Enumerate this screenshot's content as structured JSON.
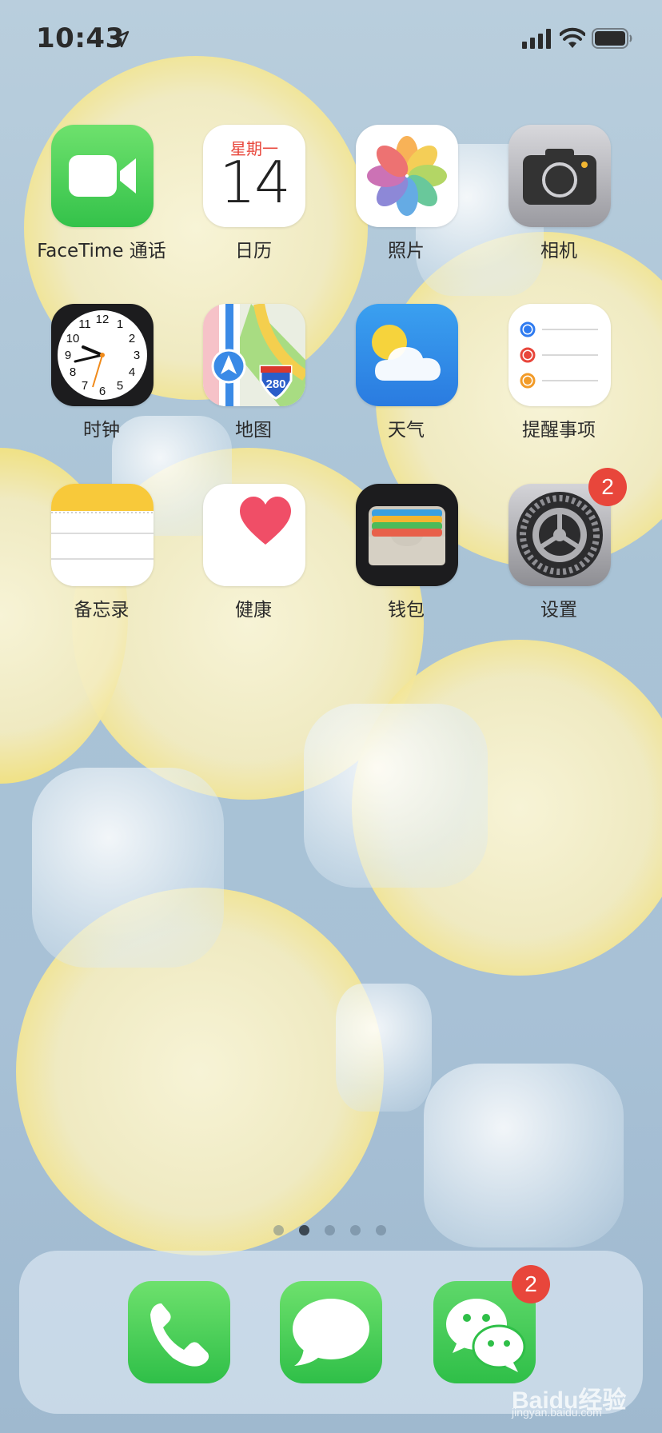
{
  "status_bar": {
    "time": "10:43",
    "location_icon": "location-arrow-icon",
    "signal_icon": "cellular-signal-icon",
    "wifi_icon": "wifi-icon",
    "battery_icon": "battery-icon"
  },
  "apps": [
    {
      "label": "FaceTime 通话",
      "icon": "facetime-icon"
    },
    {
      "label": "日历",
      "icon": "calendar-icon",
      "weekday": "星期一",
      "day": "14"
    },
    {
      "label": "照片",
      "icon": "photos-icon"
    },
    {
      "label": "相机",
      "icon": "camera-icon"
    },
    {
      "label": "时钟",
      "icon": "clock-icon",
      "clock_numbers": [
        "12",
        "1",
        "2",
        "3",
        "4",
        "5",
        "6",
        "7",
        "8",
        "9",
        "10",
        "11"
      ]
    },
    {
      "label": "地图",
      "icon": "maps-icon",
      "highway": "280"
    },
    {
      "label": "天气",
      "icon": "weather-icon"
    },
    {
      "label": "提醒事项",
      "icon": "reminders-icon"
    },
    {
      "label": "备忘录",
      "icon": "notes-icon"
    },
    {
      "label": "健康",
      "icon": "health-icon"
    },
    {
      "label": "钱包",
      "icon": "wallet-icon"
    },
    {
      "label": "设置",
      "icon": "settings-icon",
      "badge": "2"
    }
  ],
  "page_indicator": {
    "count": 5,
    "active_index": 1
  },
  "dock": [
    {
      "icon": "phone-icon"
    },
    {
      "icon": "messages-icon"
    },
    {
      "icon": "wechat-icon",
      "badge": "2"
    }
  ],
  "watermark": {
    "text": "Baidu经验",
    "sub": "jingyan.baidu.com"
  },
  "colors": {
    "badge": "#e8463b",
    "green": "#4cd964",
    "calendar_red": "#e8463b"
  }
}
